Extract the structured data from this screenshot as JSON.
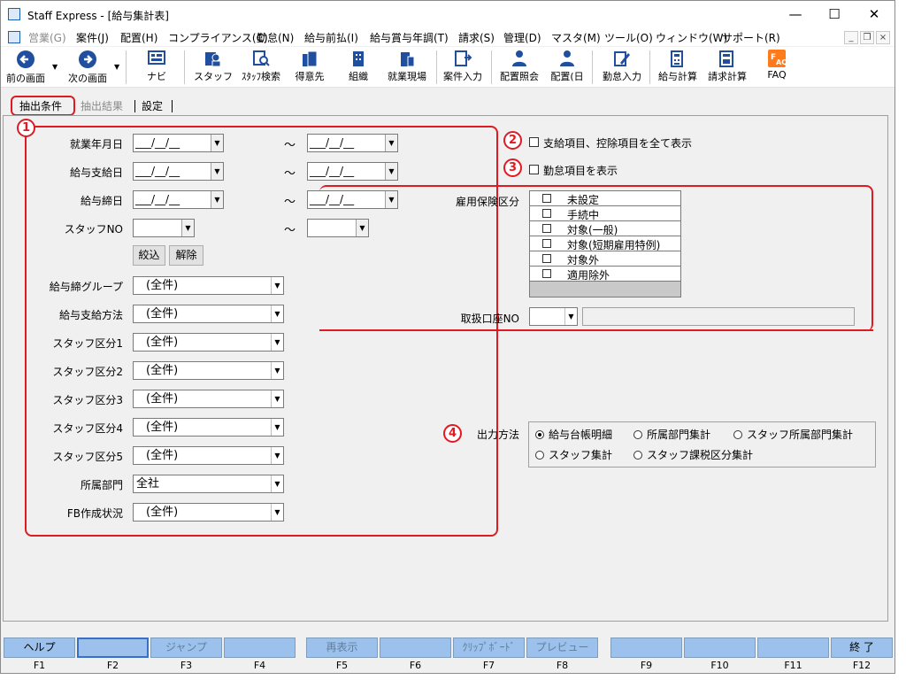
{
  "window": {
    "title": "Staff Express - [給与集計表]"
  },
  "menu": [
    "営業(G)",
    "案件(J)",
    "配置(H)",
    "コンプライアンス(C)",
    "勤怠(N)",
    "給与前払(I)",
    "給与賞与年調(T)",
    "請求(S)",
    "管理(D)",
    "マスタ(M)",
    "ツール(O)",
    "ウィンドウ(W)",
    "サポート(R)"
  ],
  "toolbar": {
    "back": "前の画面",
    "forward": "次の画面",
    "navi": "ナビ",
    "staff": "スタッフ",
    "staff_search": "ｽﾀｯﾌ検索",
    "client": "得意先",
    "org": "組織",
    "site": "就業現場",
    "case_input": "案件入力",
    "assign_view": "配置照会",
    "assign_day": "配置(日",
    "attendance_input": "勤怠入力",
    "pay_calc": "給与計算",
    "bill_calc": "請求計算",
    "faq": "FAQ"
  },
  "tabs": {
    "conditions": "抽出条件",
    "results": "抽出結果",
    "settings": "設定"
  },
  "form": {
    "work_month_label": "就業年月日",
    "pay_date_label": "給与支給日",
    "close_date_label": "給与締日",
    "staff_no_label": "スタッフNO",
    "date_blank": "___/__/__",
    "tilde": "～",
    "narrow_button": "絞込",
    "clear_button": "解除",
    "close_group_label": "給与締グループ",
    "close_group_value": "(全件)",
    "pay_method_label": "給与支給方法",
    "pay_method_value": "(全件)",
    "staff_cat1_label": "スタッフ区分1",
    "staff_cat1_value": "(全件)",
    "staff_cat2_label": "スタッフ区分2",
    "staff_cat2_value": "(全件)",
    "staff_cat3_label": "スタッフ区分3",
    "staff_cat3_value": "(全件)",
    "staff_cat4_label": "スタッフ区分4",
    "staff_cat4_value": "(全件)",
    "staff_cat5_label": "スタッフ区分5",
    "staff_cat5_value": "(全件)",
    "dept_label": "所属部門",
    "dept_value": "全社",
    "fb_label": "FB作成状況",
    "fb_value": "(全件)"
  },
  "options": {
    "show_all_items": "支給項目、控除項目を全て表示",
    "show_attendance": "勤怠項目を表示"
  },
  "insurance": {
    "label": "雇用保険区分",
    "items": [
      "未設定",
      "手続中",
      "対象(一般)",
      "対象(短期雇用特例)",
      "対象外",
      "適用除外"
    ]
  },
  "account": {
    "label": "取扱口座NO"
  },
  "output": {
    "label": "出力方法",
    "options": [
      "給与台帳明細",
      "所属部門集計",
      "スタッフ所属部門集計",
      "スタッフ集計",
      "スタッフ課税区分集計"
    ],
    "selected": "給与台帳明細"
  },
  "callouts": [
    "1",
    "2",
    "3",
    "4"
  ],
  "fkeys": [
    {
      "key": "F1",
      "label": "ヘルプ"
    },
    {
      "key": "F2",
      "label": ""
    },
    {
      "key": "F3",
      "label": "ジャンプ"
    },
    {
      "key": "F4",
      "label": ""
    },
    {
      "key": "F5",
      "label": "再表示"
    },
    {
      "key": "F6",
      "label": ""
    },
    {
      "key": "F7",
      "label": "ｸﾘｯﾌﾟﾎﾞｰﾄﾞ"
    },
    {
      "key": "F8",
      "label": "プレビュー"
    },
    {
      "key": "F9",
      "label": ""
    },
    {
      "key": "F10",
      "label": ""
    },
    {
      "key": "F11",
      "label": ""
    },
    {
      "key": "F12",
      "label": "終 了"
    }
  ],
  "colors": {
    "callout": "#e01a22",
    "fkey": "#9cc1ec",
    "panel": "#f0f0f0"
  }
}
